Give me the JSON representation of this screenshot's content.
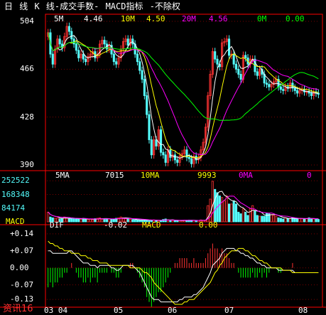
{
  "title": {
    "text": "日 线 K 线-成交手数- MACD指标 -不除权",
    "color": "#ffffff"
  },
  "price_panel": {
    "ma_labels": [
      {
        "text": "5M",
        "color": "#ffffff"
      },
      {
        "text": "4.46",
        "color": "#ffffff"
      },
      {
        "text": "10M",
        "color": "#ffff00"
      },
      {
        "text": "4.50",
        "color": "#ffff00"
      },
      {
        "text": "20M",
        "color": "#ff00ff"
      },
      {
        "text": "4.56",
        "color": "#ff00ff"
      },
      {
        "text": "0M",
        "color": "#00ff00"
      },
      {
        "text": "0.00",
        "color": "#00ff00"
      }
    ],
    "y_ticks": [
      "504",
      "466",
      "428",
      "390"
    ]
  },
  "volume_panel": {
    "ma_labels": [
      {
        "text": "5MA",
        "color": "#ffffff"
      },
      {
        "text": "7015",
        "color": "#ffffff"
      },
      {
        "text": "10MA",
        "color": "#ffff00"
      },
      {
        "text": "9993",
        "color": "#ffff00"
      },
      {
        "text": "0MA",
        "color": "#ff00ff"
      },
      {
        "text": "0",
        "color": "#ff00ff"
      }
    ],
    "y_ticks": [
      "252522",
      "168348",
      "84174"
    ]
  },
  "macd_panel": {
    "name": "MACD",
    "labels": [
      {
        "text": "DIF",
        "color": "#ffffff"
      },
      {
        "text": "-0.02",
        "color": "#ffffff"
      },
      {
        "text": "MACD",
        "color": "#ffff00"
      },
      {
        "text": "0.00",
        "color": "#ffff00"
      }
    ],
    "y_ticks": [
      "+0.14",
      "+0.07",
      "0.00",
      "-0.07",
      "-0.13"
    ]
  },
  "x_ticks": [
    "03 04",
    "05",
    "06",
    "07",
    "08"
  ],
  "footer": {
    "info": "资讯16"
  },
  "colors": {
    "up": "#ff3232",
    "down": "#54fcfc",
    "frame": "#ff0000",
    "ma5": "#ffffff",
    "ma10": "#ffff00",
    "ma20": "#ff00ff",
    "ma60": "#00ff00"
  },
  "chart_data": [
    {
      "type": "candlestick",
      "ylim": [
        390,
        504
      ],
      "close": [
        495,
        478,
        470,
        482,
        490,
        486,
        483,
        492,
        500,
        496,
        490,
        486,
        481,
        475,
        478,
        474,
        472,
        476,
        478,
        480,
        475,
        478,
        486,
        489,
        486,
        482,
        485,
        478,
        472,
        470,
        475,
        482,
        488,
        490,
        485,
        490,
        486,
        478,
        472,
        465,
        458,
        445,
        430,
        410,
        398,
        410,
        405,
        418,
        400,
        398,
        392,
        402,
        396,
        398,
        394,
        392,
        397,
        399,
        402,
        396,
        395,
        391,
        397,
        394,
        396,
        402,
        408,
        420,
        445,
        462,
        480,
        474,
        470,
        468,
        487,
        488,
        490,
        477,
        478,
        470,
        466,
        462,
        458,
        477,
        475,
        470,
        474,
        474,
        464,
        461,
        466,
        462,
        455,
        454,
        452,
        454,
        456,
        458,
        452,
        450,
        449,
        452,
        451,
        455,
        451,
        449,
        447,
        449,
        450,
        448,
        448,
        447,
        445,
        448,
        447,
        446
      ]
    },
    {
      "type": "bar",
      "ylim": [
        0,
        280000
      ],
      "values": [
        60000,
        30000,
        25000,
        22000,
        25000,
        18000,
        20000,
        30000,
        22000,
        18000,
        25000,
        18000,
        20000,
        18000,
        15000,
        22000,
        20000,
        15000,
        16000,
        13000,
        20000,
        22000,
        25000,
        16000,
        18000,
        20000,
        18000,
        15000,
        16000,
        22000,
        25000,
        30000,
        25000,
        20000,
        18000,
        16000,
        14000,
        12000,
        11000,
        10000,
        12000,
        15000,
        10000,
        8000,
        9000,
        12000,
        10000,
        8000,
        7000,
        15000,
        18000,
        12000,
        10000,
        8000,
        7000,
        8000,
        9000,
        8000,
        9000,
        10000,
        11000,
        10000,
        8000,
        7000,
        8000,
        12000,
        10000,
        8000,
        100000,
        140000,
        250000,
        200000,
        180000,
        160000,
        150000,
        130000,
        160000,
        110000,
        110000,
        130000,
        110000,
        60000,
        50000,
        80000,
        60000,
        40000,
        80000,
        100000,
        70000,
        40000,
        35000,
        35000,
        35000,
        55000,
        50000,
        45000,
        40000,
        35000,
        25000,
        22000,
        18000,
        25000,
        20000,
        20000,
        25000,
        20000,
        18000,
        22000,
        20000,
        18000,
        20000,
        25000,
        20000,
        18000,
        16000,
        15000
      ]
    },
    {
      "type": "line",
      "ylim": [
        -0.15,
        0.16
      ],
      "series": [
        {
          "name": "DIF",
          "values": [
            0.07,
            0.07,
            0.06,
            0.06,
            0.06,
            0.06,
            0.06,
            0.06,
            0.06,
            0.07,
            0.07,
            0.06,
            0.05,
            0.04,
            0.03,
            0.02,
            0.02,
            0.02,
            0.01,
            0.01,
            0.01,
            0.0,
            0.01,
            0.01,
            0.01,
            0.01,
            0.01,
            0.0,
            0.0,
            -0.01,
            -0.01,
            0.0,
            0.01,
            0.01,
            0.01,
            0.01,
            0.01,
            0.0,
            -0.01,
            -0.02,
            -0.04,
            -0.06,
            -0.08,
            -0.1,
            -0.12,
            -0.13,
            -0.13,
            -0.13,
            -0.14,
            -0.14,
            -0.14,
            -0.14,
            -0.14,
            -0.14,
            -0.14,
            -0.14,
            -0.13,
            -0.13,
            -0.12,
            -0.12,
            -0.12,
            -0.12,
            -0.11,
            -0.11,
            -0.1,
            -0.09,
            -0.08,
            -0.06,
            -0.04,
            -0.02,
            0.01,
            0.02,
            0.03,
            0.04,
            0.06,
            0.07,
            0.08,
            0.08,
            0.08,
            0.08,
            0.07,
            0.07,
            0.06,
            0.06,
            0.05,
            0.05,
            0.04,
            0.04,
            0.03,
            0.02,
            0.02,
            0.01,
            0.01,
            0.0,
            0.0,
            0.0,
            0.0,
            0.0,
            -0.01,
            -0.01,
            -0.01,
            -0.01,
            -0.01,
            -0.01,
            -0.01,
            -0.02,
            -0.02,
            -0.02,
            -0.02,
            -0.02,
            -0.02,
            -0.02,
            -0.02,
            -0.02,
            -0.02,
            -0.02
          ]
        },
        {
          "name": "MACD",
          "values": [
            0.11,
            0.1,
            0.1,
            0.09,
            0.09,
            0.08,
            0.08,
            0.07,
            0.07,
            0.07,
            0.06,
            0.06,
            0.06,
            0.06,
            0.05,
            0.05,
            0.05,
            0.04,
            0.04,
            0.03,
            0.03,
            0.03,
            0.02,
            0.02,
            0.02,
            0.02,
            0.01,
            0.01,
            0.01,
            0.01,
            0.01,
            0.01,
            0.01,
            0.01,
            0.01,
            0.0,
            0.0,
            0.0,
            0.0,
            0.0,
            -0.01,
            -0.02,
            -0.02,
            -0.03,
            -0.04,
            -0.06,
            -0.07,
            -0.08,
            -0.09,
            -0.1,
            -0.11,
            -0.12,
            -0.13,
            -0.14,
            -0.15,
            -0.15,
            -0.15,
            -0.15,
            -0.14,
            -0.14,
            -0.13,
            -0.13,
            -0.13,
            -0.12,
            -0.11,
            -0.1,
            -0.09,
            -0.08,
            -0.07,
            -0.06,
            -0.04,
            -0.02,
            -0.01,
            0.01,
            0.02,
            0.04,
            0.05,
            0.06,
            0.07,
            0.07,
            0.07,
            0.08,
            0.08,
            0.08,
            0.07,
            0.07,
            0.06,
            0.05,
            0.05,
            0.04,
            0.03,
            0.03,
            0.02,
            0.02,
            0.01,
            0.0,
            0.0,
            0.0,
            0.0,
            0.0,
            -0.01,
            -0.01,
            -0.01,
            -0.01,
            -0.02,
            -0.02,
            -0.02,
            -0.02,
            -0.02,
            -0.02,
            -0.02,
            -0.02,
            -0.02,
            -0.02,
            -0.02,
            -0.02
          ]
        }
      ]
    }
  ]
}
